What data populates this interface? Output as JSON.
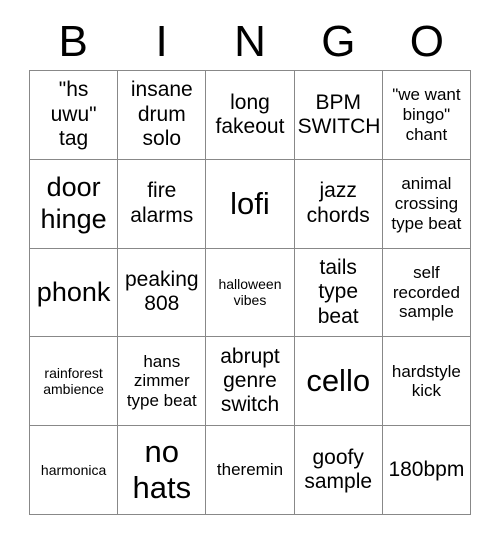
{
  "header": {
    "letters": [
      "B",
      "I",
      "N",
      "G",
      "O"
    ]
  },
  "grid": {
    "rows": [
      [
        {
          "text": "\"hs\nuwu\"\ntag",
          "size": "fs-md"
        },
        {
          "text": "insane\ndrum\nsolo",
          "size": "fs-md"
        },
        {
          "text": "long\nfakeout",
          "size": "fs-md"
        },
        {
          "text": "BPM\nSWITCH",
          "size": "fs-md"
        },
        {
          "text": "\"we want\nbingo\"\nchant",
          "size": "fs-sm"
        }
      ],
      [
        {
          "text": "door\nhinge",
          "size": "fs-lg"
        },
        {
          "text": "fire\nalarms",
          "size": "fs-md"
        },
        {
          "text": "lofi",
          "size": "fs-xl"
        },
        {
          "text": "jazz\nchords",
          "size": "fs-md"
        },
        {
          "text": "animal\ncrossing\ntype beat",
          "size": "fs-sm"
        }
      ],
      [
        {
          "text": "phonk",
          "size": "fs-lg"
        },
        {
          "text": "peaking\n808",
          "size": "fs-md"
        },
        {
          "text": "halloween\nvibes",
          "size": "fs-xs"
        },
        {
          "text": "tails\ntype\nbeat",
          "size": "fs-md"
        },
        {
          "text": "self\nrecorded\nsample",
          "size": "fs-sm"
        }
      ],
      [
        {
          "text": "rainforest\nambience",
          "size": "fs-xs"
        },
        {
          "text": "hans\nzimmer\ntype beat",
          "size": "fs-sm"
        },
        {
          "text": "abrupt\ngenre\nswitch",
          "size": "fs-md"
        },
        {
          "text": "cello",
          "size": "fs-xl"
        },
        {
          "text": "hardstyle\nkick",
          "size": "fs-sm"
        }
      ],
      [
        {
          "text": "harmonica",
          "size": "fs-xs"
        },
        {
          "text": "no\nhats",
          "size": "fs-xl"
        },
        {
          "text": "theremin",
          "size": "fs-sm"
        },
        {
          "text": "goofy\nsample",
          "size": "fs-md"
        },
        {
          "text": "180bpm",
          "size": "fs-md"
        }
      ]
    ]
  },
  "colors": {
    "grid_line": "#888888",
    "text": "#000000",
    "background": "#ffffff"
  }
}
